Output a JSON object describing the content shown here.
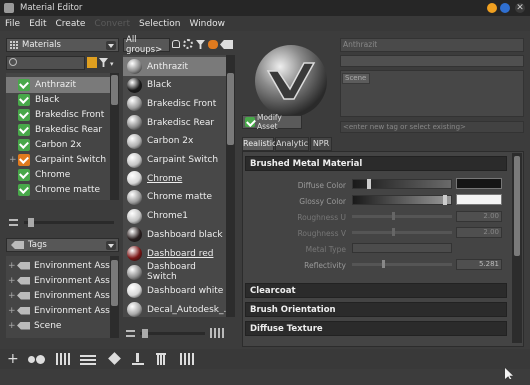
{
  "window": {
    "title": "Material Editor"
  },
  "menu": [
    "File",
    "Edit",
    "Create",
    "Convert",
    "Selection",
    "Window"
  ],
  "left_panel": {
    "dropdown": "Materials",
    "search_placeholder": "",
    "items": [
      {
        "label": "Anthrazit",
        "selected": true,
        "icon": "check-icon"
      },
      {
        "label": "Black",
        "icon": "check-icon"
      },
      {
        "label": "Brakedisc Front",
        "icon": "check-icon"
      },
      {
        "label": "Brakedisc Rear",
        "icon": "check-icon"
      },
      {
        "label": "Carbon 2x",
        "icon": "check-icon"
      },
      {
        "label": "Carpaint Switch",
        "icon": "switch-icon",
        "expandable": true
      },
      {
        "label": "Chrome",
        "icon": "check-icon"
      },
      {
        "label": "Chrome matte",
        "icon": "check-icon"
      }
    ],
    "tags_dropdown": "Tags",
    "tags": [
      "Environment Asset: B",
      "Environment Asset: C",
      "Environment Asset: G",
      "Environment Asset: S",
      "Scene"
    ]
  },
  "middle_panel": {
    "dropdown": "All groups>",
    "items": [
      {
        "label": "Anthrazit",
        "selected": true,
        "color": "#8a8a8a"
      },
      {
        "label": "Black",
        "color": "#1b1b1b"
      },
      {
        "label": "Brakedisc Front",
        "color": "#9a9a9a"
      },
      {
        "label": "Brakedisc Rear",
        "color": "#8d8d8d"
      },
      {
        "label": "Carbon 2x",
        "color": "#b0b0b0"
      },
      {
        "label": "Carpaint Switch",
        "color": "#c4c4c4"
      },
      {
        "label": "Chrome",
        "color": "#d6d6d6",
        "underline": true
      },
      {
        "label": "Chrome matte",
        "color": "#9d9d9d"
      },
      {
        "label": "Chrome1",
        "color": "#c2c2c2"
      },
      {
        "label": "Dashboard black",
        "color": "#2a2020"
      },
      {
        "label": "Dashboard red",
        "color": "#7a1414",
        "underline": true
      },
      {
        "label": "Dashboard Switch",
        "color": "#8e8e8e"
      },
      {
        "label": "Dashboard white",
        "color": "#d8d8d8"
      },
      {
        "label": "Decal_Autodesk_...",
        "color": "#a8a8a8"
      }
    ]
  },
  "right_panel": {
    "material_name": "Anthrazit",
    "tag_value": "Scene",
    "modify_button": "Modify Asset",
    "tag_placeholder": "<enter new tag or select existing>",
    "tabs": [
      "Realistic",
      "Analytic",
      "NPR"
    ],
    "active_tab": "Realistic",
    "section_title": "Brushed Metal Material",
    "properties": [
      {
        "label": "Diffuse Color"
      },
      {
        "label": "Glossy Color"
      },
      {
        "label": "Roughness U",
        "value": "2.00"
      },
      {
        "label": "Roughness V",
        "value": "2.00"
      },
      {
        "label": "Metal Type"
      },
      {
        "label": "Reflectivity",
        "value": "5.281"
      }
    ],
    "collapsed_sections": [
      "Clearcoat",
      "Brush Orientation",
      "Diffuse Texture"
    ]
  },
  "colors": {
    "accent_green": "#48a84a",
    "title_orange": "#f0a020",
    "selection": "#7a7a7a"
  }
}
